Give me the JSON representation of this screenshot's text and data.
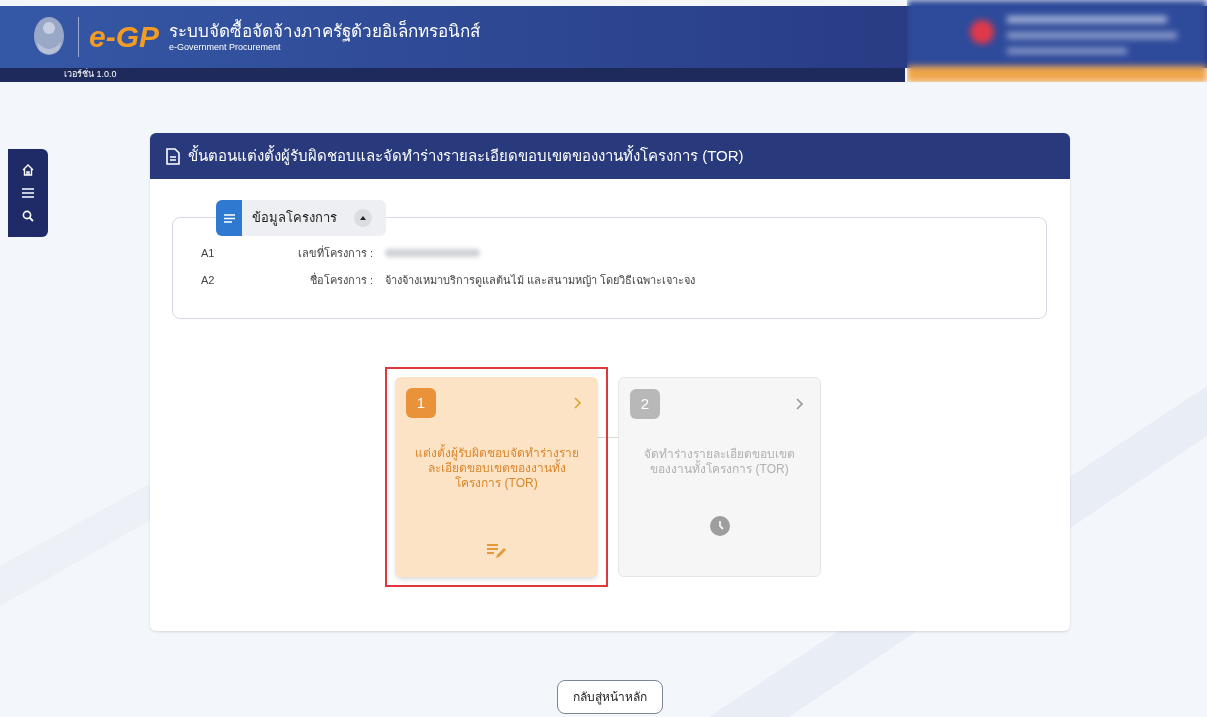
{
  "header": {
    "logo_text": "e-GP",
    "title": "ระบบจัดซื้อจัดจ้างภาครัฐด้วยอิเล็กทรอนิกส์",
    "subtitle": "e-Government Procurement",
    "version": "เวอร์ชั่น 1.0.0"
  },
  "sidebar": {
    "items": [
      {
        "kind": "home"
      },
      {
        "kind": "menu"
      },
      {
        "kind": "search"
      }
    ]
  },
  "panel": {
    "title": "ขั้นตอนแต่งตั้งผู้รับผิดชอบและจัดทำร่างรายละเอียดขอบเขตของงานทั้งโครงการ (TOR)",
    "project_info": {
      "legend": "ข้อมูลโครงการ",
      "expanded": true,
      "fields": [
        {
          "code": "A1",
          "label": "เลขที่โครงการ :",
          "redacted": true
        },
        {
          "code": "A2",
          "label": "ชื่อโครงการ :",
          "value": "จ้างจ้างเหมาบริการดูแลต้นไม้ และสนามหญ้า โดยวิธีเฉพาะเจาะจง",
          "redacted": false
        }
      ]
    },
    "steps": [
      {
        "number": "1",
        "label": "แต่งตั้งผู้รับผิดชอบจัดทำร่างรายละเอียดขอบเขตของงานทั้งโครงการ (TOR)",
        "kind": "in_progress",
        "selected": true
      },
      {
        "number": "2",
        "label": "จัดทำร่างรายละเอียดขอบเขตของงานทั้งโครงการ (TOR)",
        "kind": "pending",
        "selected": false
      }
    ]
  },
  "back_button": "กลับสู่หน้าหลัก"
}
